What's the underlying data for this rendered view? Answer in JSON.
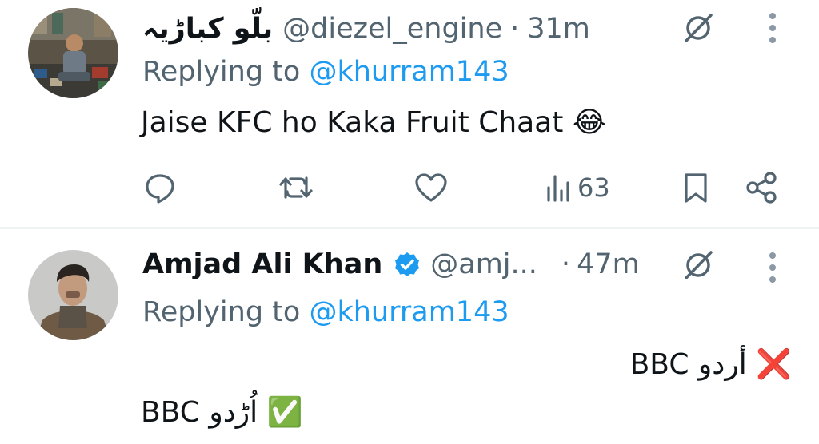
{
  "tweets": [
    {
      "display_name": "بلّو کباڑیہ",
      "handle": "@diezel_engine",
      "separator": "·",
      "time": "31m",
      "replying_prefix": "Replying to",
      "replying_to": "@khurram143",
      "text_line1": "Jaise KFC ho Kaka Fruit Chaat 😂",
      "views": "63",
      "icons": [
        "avatar",
        "grok-icon",
        "more-icon",
        "reply-icon",
        "retweet-icon",
        "like-icon",
        "views-icon",
        "bookmark-icon",
        "share-icon"
      ]
    },
    {
      "display_name": "Amjad Ali Khan",
      "handle": "@amj...",
      "separator": "·",
      "time": "47m",
      "replying_prefix": "Replying to",
      "replying_to": "@khurram143",
      "text_line1": "BBC أردو ❌",
      "text_line2": "BBC اُڑدو ✅",
      "icons": [
        "avatar",
        "verified-icon",
        "grok-icon",
        "more-icon"
      ]
    }
  ],
  "colors": {
    "text": "#0f1419",
    "secondary": "#536471",
    "accent": "#1d9bf0",
    "divider": "#eff3f4"
  }
}
